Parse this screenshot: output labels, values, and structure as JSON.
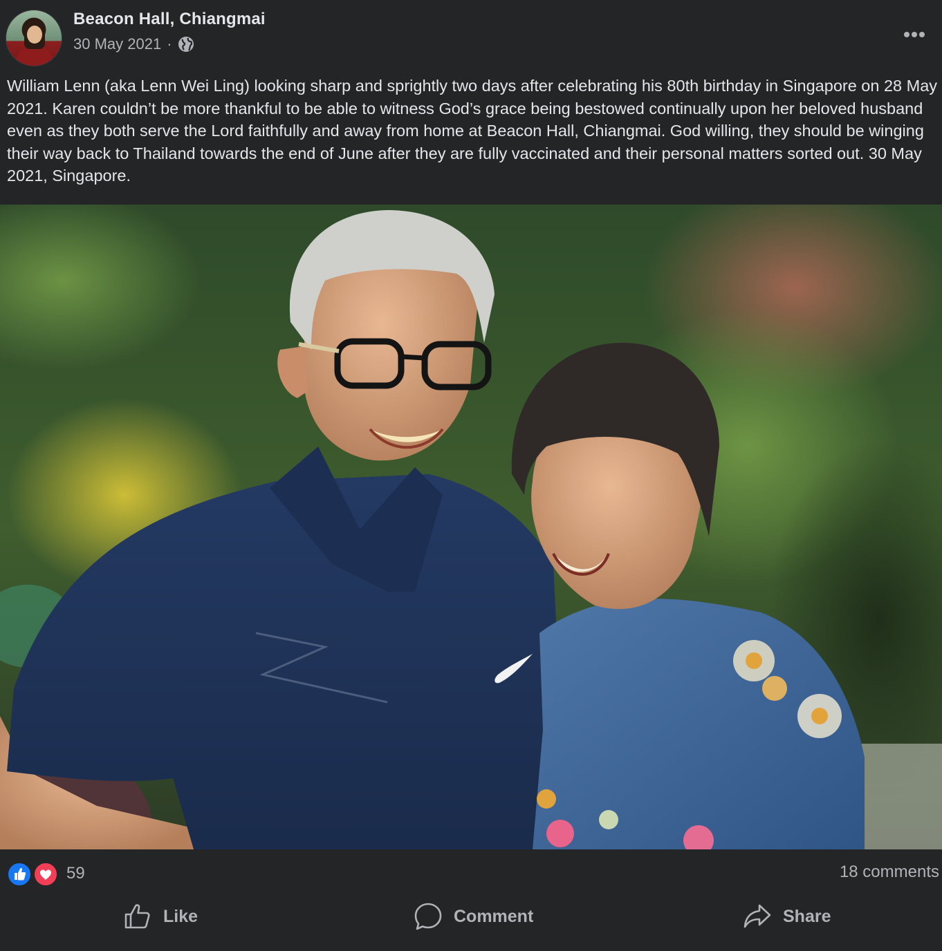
{
  "post": {
    "page_name": "Beacon Hall, Chiangmai",
    "date": "30 May 2021",
    "separator": "·",
    "privacy_icon": "globe-icon",
    "more_icon": "more-options-icon",
    "caption": "William Lenn (aka Lenn Wei Ling) looking sharp and sprightly two days after celebrating his 80th birthday in Singapore on 28 May 2021. Karen couldn’t be more thankful to be able to witness God’s grace being bestowed continually upon her beloved husband even as they both serve the Lord faithfully and away from home at Beacon Hall, Chiangmai. God willing, they should be winging their way back to Thailand towards the end of June after they are fully vaccinated and their personal matters sorted out. 30 May 2021, Singapore."
  },
  "reactions": {
    "icons": [
      "like-icon",
      "love-icon"
    ],
    "count": "59",
    "comments": "18 comments"
  },
  "actions": {
    "like": "Like",
    "comment": "Comment",
    "share": "Share"
  },
  "colors": {
    "background": "#242526",
    "text_primary": "#e4e6eb",
    "text_secondary": "#b0b3b8",
    "like_blue": "#1877f2",
    "love_red": "#f33e58"
  }
}
